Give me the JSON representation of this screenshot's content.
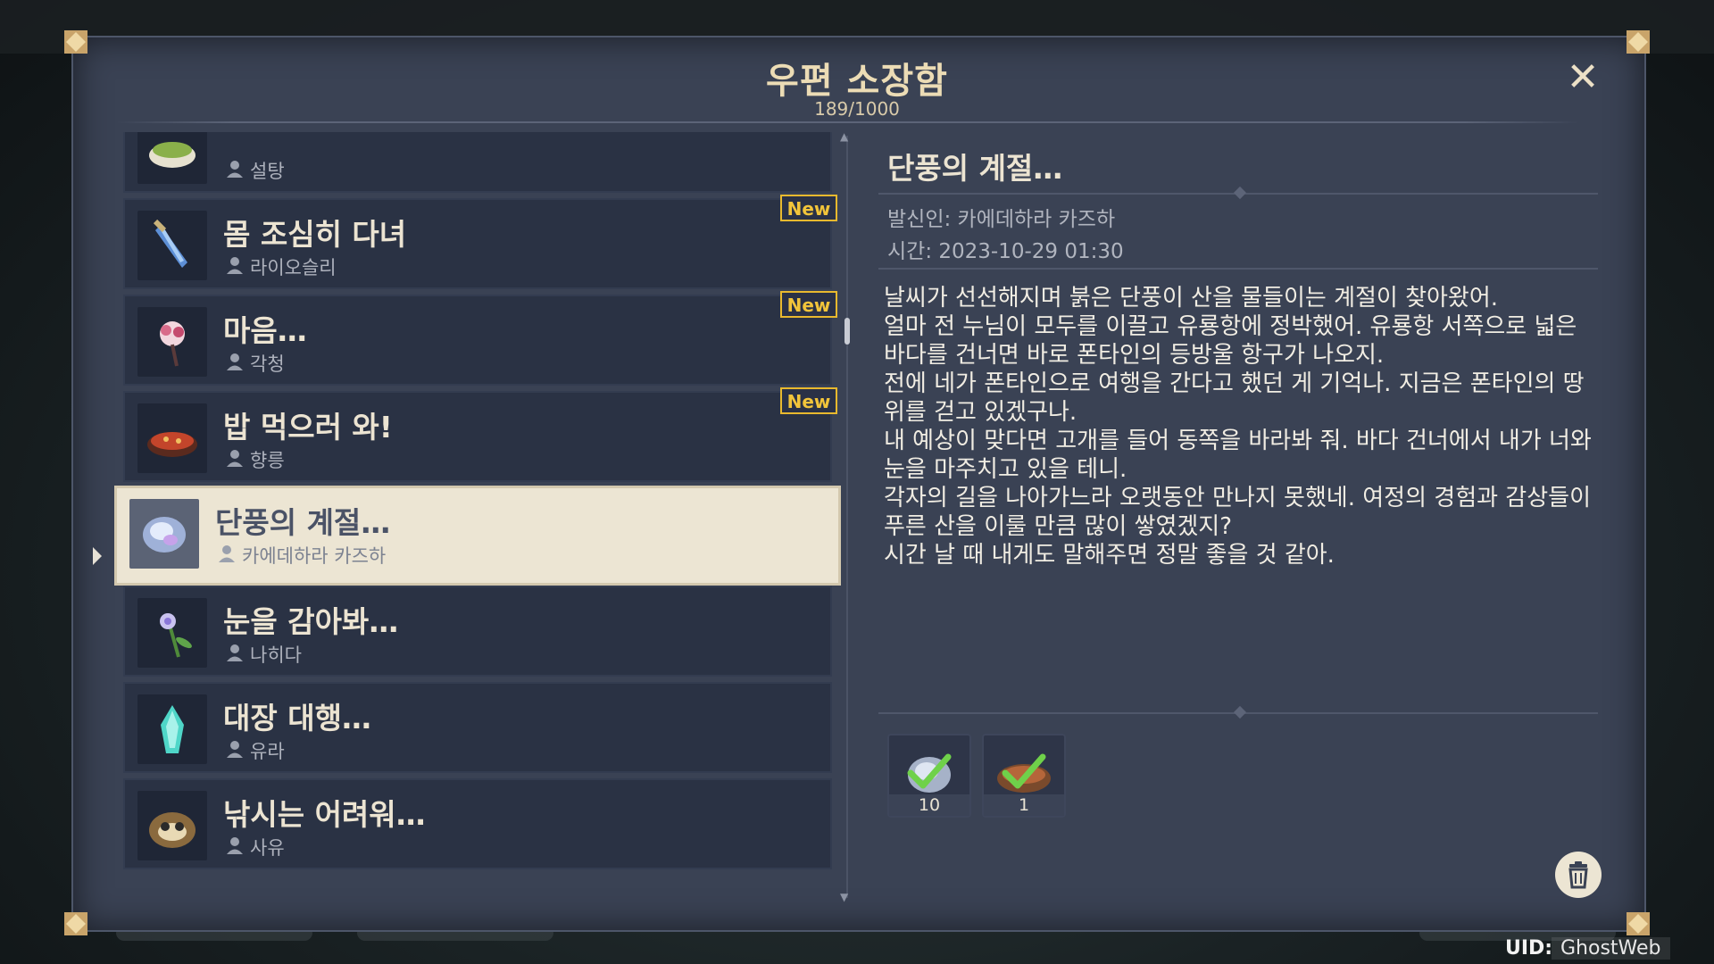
{
  "mailbox": {
    "title": "우편 소장함",
    "count": "189/1000",
    "close_label": "✕"
  },
  "mail_list": [
    {
      "subject": "",
      "sender": "설탕",
      "icon": "food-bowl-icon",
      "is_new": false,
      "selected": false
    },
    {
      "subject": "몸 조심히 다녀",
      "sender": "라이오슬리",
      "icon": "crystal-dagger-icon",
      "is_new": true,
      "selected": false
    },
    {
      "subject": "마음…",
      "sender": "각청",
      "icon": "flower-bouquet-icon",
      "is_new": true,
      "selected": false
    },
    {
      "subject": "밥 먹으러 와!",
      "sender": "향릉",
      "icon": "spicy-dish-icon",
      "is_new": true,
      "selected": false
    },
    {
      "subject": "단풍의 계절…",
      "sender": "카에데하라 카즈하",
      "icon": "crystal-core-icon",
      "is_new": false,
      "selected": true
    },
    {
      "subject": "눈을 감아봐…",
      "sender": "나히다",
      "icon": "flower-icon",
      "is_new": false,
      "selected": false
    },
    {
      "subject": "대장 대행…",
      "sender": "유라",
      "icon": "ice-crystal-icon",
      "is_new": false,
      "selected": false
    },
    {
      "subject": "낚시는 어려워…",
      "sender": "사유",
      "icon": "tanuki-icon",
      "is_new": false,
      "selected": false
    }
  ],
  "new_badge_label": "New",
  "detail": {
    "title": "단풍의 계절…",
    "sender_label": "발신인: 카에데하라 카즈하",
    "time_label": "시간: 2023-10-29 01:30",
    "body_lines": [
      "날씨가 선선해지며 붉은 단풍이 산을 물들이는 계절이 찾아왔어.",
      "얼마 전 누님이 모두를 이끌고 유룡항에 정박했어. 유룡항 서쪽으로 넓은",
      "바다를 건너면 바로 폰타인의 등방울 항구가 나오지.",
      "전에 네가 폰타인으로 여행을 간다고 했던 게 기억나. 지금은 폰타인의 땅",
      "위를 걷고 있겠구나.",
      "내 예상이 맞다면 고개를 들어 동쪽을 바라봐 줘. 바다 건너에서 내가 너와",
      "눈을 마주치고 있을 테니.",
      "각자의 길을 나아가느라 오랫동안 만나지 못했네. 여정의 경험과 감상들이",
      "푸른 산을 이룰 만큼 많이 쌓였겠지?",
      "시간 날 때 내게도 말해주면 정말 좋을 것 같아."
    ],
    "attachments": [
      {
        "icon": "crystal-core-icon",
        "quantity": "10",
        "claimed": true
      },
      {
        "icon": "grilled-dish-icon",
        "quantity": "1",
        "claimed": true
      }
    ]
  },
  "footer": {
    "uid_label": "UID:",
    "uid_value": "GhostWeb"
  },
  "colors": {
    "panel": "#3a4254",
    "item_bg": "#2a3244",
    "selected_bg": "#ece5d3",
    "title_gold": "#ecdcb5",
    "new_badge": "#f2c43a",
    "check_green": "#6fd14a"
  }
}
